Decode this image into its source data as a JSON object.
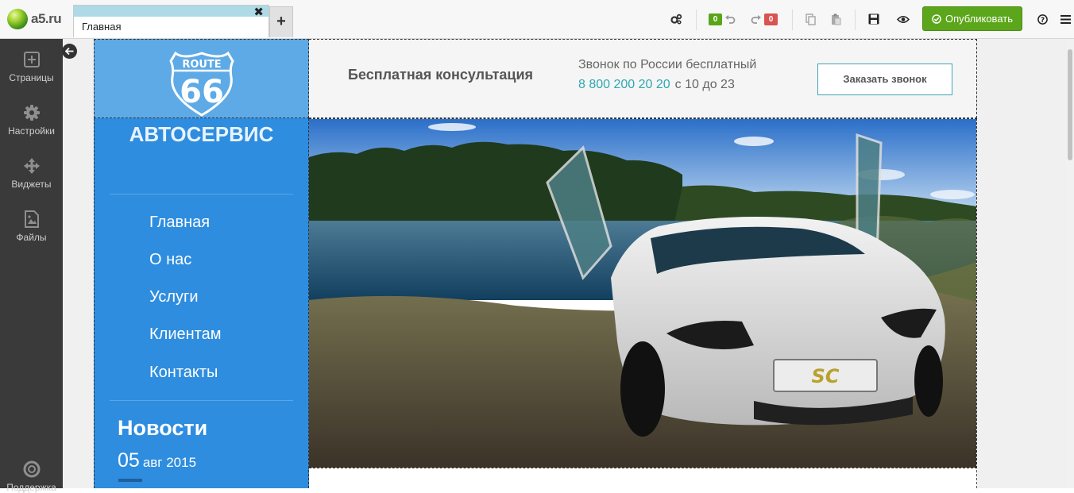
{
  "app": {
    "logo_text": "a5.ru",
    "tab_label": "Главная",
    "tab_close": "✖",
    "tab_add": "+",
    "undo_count": "0",
    "redo_count": "0",
    "publish_label": "Опубликовать",
    "accent_color": "#5ba61a"
  },
  "sidebar": {
    "items": [
      {
        "label": "Страницы",
        "icon": "add-page-icon"
      },
      {
        "label": "Настройки",
        "icon": "gear-icon"
      },
      {
        "label": "Виджеты",
        "icon": "move-arrows-icon"
      },
      {
        "label": "Файлы",
        "icon": "image-file-icon"
      },
      {
        "label": "Поддержка",
        "icon": "lifebuoy-icon"
      }
    ]
  },
  "site": {
    "logo": {
      "top": "ROUTE",
      "number": "66"
    },
    "brand": "АВТОСЕРВИС",
    "consult": "Бесплатная консультация",
    "call_text": "Звонок по России бесплатный",
    "phone": "8 800 200 20 20",
    "hours": "с 10 до 23",
    "order_button": "Заказать звонок",
    "nav": [
      "Главная",
      "О нас",
      "Услуги",
      "Клиентам",
      "Контакты"
    ],
    "news_title": "Новости",
    "news_day": "05",
    "news_month_year": "авг 2015",
    "hero_plate": "SC",
    "colors": {
      "header_blue": "#5eaae6",
      "column_blue": "#2e8ddf",
      "phone_teal": "#2ea7b2"
    }
  }
}
